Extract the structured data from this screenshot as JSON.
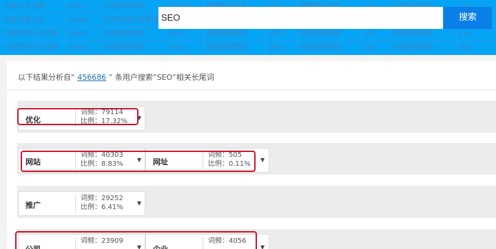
{
  "bg_table": {
    "rows": [
      [
        "抖音大全流量",
        "41617",
        "抖音商城网站",
        "15209",
        "流量网站排名",
        "7817",
        "流量网站排名",
        "134",
        "抖音分享网站",
        "124"
      ],
      [
        "抖音流量大全",
        "40889",
        "抖音商城抖音商城",
        "3325",
        "流量网站排行",
        "4445",
        "流量网站排名网",
        "124",
        "抖音网站排名",
        "124"
      ],
      [
        "抖音营销大全营销",
        "24695",
        "抖音营销网站",
        "8443",
        "流量营销策划",
        "1974",
        "抖音营销网站",
        "107",
        "抖音营销网站",
        "112"
      ],
      [
        "抖音营销大全营销",
        "24592",
        "抖音营销网站",
        "8401",
        "流量营销策划",
        "1901",
        "抖音营销网站",
        "103",
        "抖音营销网站",
        "108"
      ]
    ]
  },
  "search": {
    "value": "SEO",
    "button_label": "搜索"
  },
  "summary": {
    "prefix": "以下结果分析自“ ",
    "count": "456686",
    "suffix": " ” 条用户搜索“SEO”相关长尾词"
  },
  "groups": [
    {
      "cards": [
        {
          "keyword": "优化",
          "freq": "词频：79114",
          "ratio": "比例：17.32%"
        }
      ]
    },
    {
      "cards": [
        {
          "keyword": "网站",
          "freq": "词频：40303",
          "ratio": "比例：8.83%"
        },
        {
          "keyword": "网址",
          "freq": "词频：505",
          "ratio": "比例：0.11%"
        }
      ]
    },
    {
      "cards": [
        {
          "keyword": "推广",
          "freq": "词频：29252",
          "ratio": "比例：6.41%"
        }
      ]
    },
    {
      "cards": [
        {
          "keyword": "公司",
          "freq": "词频：23909",
          "ratio": ""
        },
        {
          "keyword": "企业",
          "freq": "词频：4056",
          "ratio": ""
        }
      ]
    }
  ],
  "caret_icon": "chevron-down-icon",
  "colors": {
    "header": "#06a4f4",
    "button": "#0a7fe8",
    "highlight": "#d0122a",
    "link": "#1d6fb8"
  }
}
